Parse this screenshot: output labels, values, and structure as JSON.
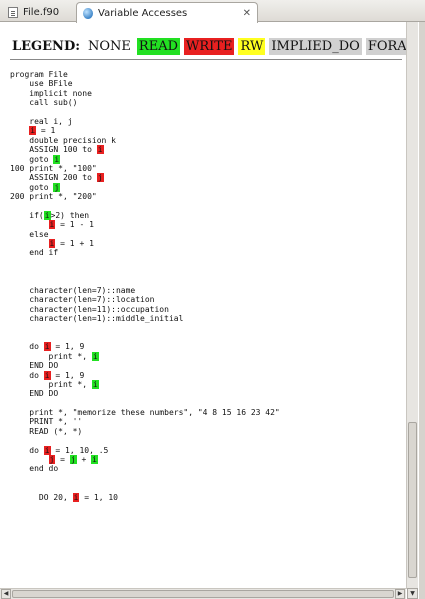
{
  "tabs": [
    {
      "label": "File.f90",
      "icon": "document-icon",
      "active": false
    },
    {
      "label": "Variable Accesses",
      "icon": "globe-icon",
      "active": true,
      "close": "✕"
    }
  ],
  "legend": {
    "title": "LEGEND:",
    "items": [
      {
        "label": "NONE",
        "color": ""
      },
      {
        "label": "READ",
        "color": "#22e022"
      },
      {
        "label": "WRITE",
        "color": "#e82020"
      },
      {
        "label": "RW",
        "color": "#ffff20"
      },
      {
        "label": "IMPLIED_DO",
        "color": "#d0d0d0"
      },
      {
        "label": "FORA",
        "color": "#d0d0d0"
      }
    ]
  },
  "code_lines": [
    [
      {
        "t": "program File"
      }
    ],
    [
      {
        "t": "    use BFile"
      }
    ],
    [
      {
        "t": "    implicit none"
      }
    ],
    [
      {
        "t": "    call sub()"
      }
    ],
    [
      {
        "t": ""
      }
    ],
    [
      {
        "t": "    real i, j"
      }
    ],
    [
      {
        "t": "    "
      },
      {
        "t": "i",
        "h": "write"
      },
      {
        "t": " = 1"
      }
    ],
    [
      {
        "t": "    double precision k"
      }
    ],
    [
      {
        "t": "    ASSIGN 100 to "
      },
      {
        "t": "i",
        "h": "write"
      }
    ],
    [
      {
        "t": "    goto "
      },
      {
        "t": "i",
        "h": "read"
      }
    ],
    [
      {
        "t": "100 print *, \"100\""
      }
    ],
    [
      {
        "t": "    ASSIGN 200 to "
      },
      {
        "t": "j",
        "h": "write"
      }
    ],
    [
      {
        "t": "    goto "
      },
      {
        "t": "j",
        "h": "read"
      }
    ],
    [
      {
        "t": "200 print *, \"200\""
      }
    ],
    [
      {
        "t": ""
      }
    ],
    [
      {
        "t": "    if("
      },
      {
        "t": "i",
        "h": "read"
      },
      {
        "t": ">2) then"
      }
    ],
    [
      {
        "t": "        "
      },
      {
        "t": "i",
        "h": "write"
      },
      {
        "t": " = 1 - 1"
      }
    ],
    [
      {
        "t": "    else"
      }
    ],
    [
      {
        "t": "        "
      },
      {
        "t": "i",
        "h": "write"
      },
      {
        "t": " = 1 + 1"
      }
    ],
    [
      {
        "t": "    end if"
      }
    ],
    [
      {
        "t": ""
      }
    ],
    [
      {
        "t": ""
      }
    ],
    [
      {
        "t": ""
      }
    ],
    [
      {
        "t": "    character(len=7)::name"
      }
    ],
    [
      {
        "t": "    character(len=7)::location"
      }
    ],
    [
      {
        "t": "    character(len=11)::occupation"
      }
    ],
    [
      {
        "t": "    character(len=1)::middle_initial"
      }
    ],
    [
      {
        "t": ""
      }
    ],
    [
      {
        "t": ""
      }
    ],
    [
      {
        "t": "    do "
      },
      {
        "t": "i",
        "h": "write"
      },
      {
        "t": " = 1, 9"
      }
    ],
    [
      {
        "t": "        print *, "
      },
      {
        "t": "i",
        "h": "read"
      }
    ],
    [
      {
        "t": "    END DO"
      }
    ],
    [
      {
        "t": "    do "
      },
      {
        "t": "i",
        "h": "write"
      },
      {
        "t": " = 1, 9"
      }
    ],
    [
      {
        "t": "        print *, "
      },
      {
        "t": "i",
        "h": "read"
      }
    ],
    [
      {
        "t": "    END DO"
      }
    ],
    [
      {
        "t": ""
      }
    ],
    [
      {
        "t": "    print *, \"memorize these numbers\", \"4 8 15 16 23 42\""
      }
    ],
    [
      {
        "t": "    PRINT *, ''"
      }
    ],
    [
      {
        "t": "    READ (*, *)"
      }
    ],
    [
      {
        "t": ""
      }
    ],
    [
      {
        "t": "    do "
      },
      {
        "t": "i",
        "h": "write"
      },
      {
        "t": " = 1, 10, .5"
      }
    ],
    [
      {
        "t": "        "
      },
      {
        "t": "j",
        "h": "write"
      },
      {
        "t": " = "
      },
      {
        "t": "j",
        "h": "read"
      },
      {
        "t": " + "
      },
      {
        "t": "i",
        "h": "read"
      }
    ],
    [
      {
        "t": "    end do"
      }
    ],
    [
      {
        "t": ""
      }
    ],
    [
      {
        "t": ""
      }
    ],
    [
      {
        "t": "      DO 20, "
      },
      {
        "t": "i",
        "h": "write"
      },
      {
        "t": " = 1, 10"
      }
    ]
  ],
  "scroll": {
    "up": "▲",
    "down": "▼",
    "left": "◀",
    "right": "▶"
  }
}
